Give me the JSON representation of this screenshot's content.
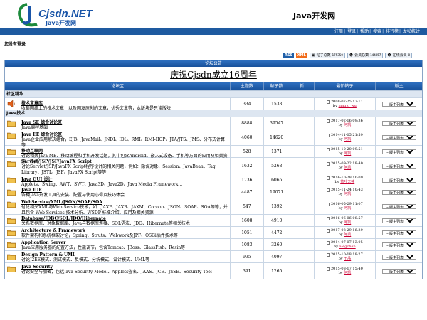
{
  "header": {
    "logo_text": "Cjsdn.NET",
    "logo_sub": "Java开发网",
    "site_title": "Java开发网"
  },
  "nav": [
    "注册",
    "登录",
    "帮助",
    "搜索",
    "排行榜",
    "发帖统计"
  ],
  "not_logged": "您没有登录",
  "infobar": {
    "rss": "RSS",
    "xml": "XML",
    "posts_label": "帖子总数",
    "posts_value": "175350",
    "members_label": "会员总数",
    "members_value": "144057",
    "online_label": "在线会员",
    "online_value": "0"
  },
  "announce_title": "论坛公告",
  "announce_text": "庆祝Cjsdn成立16周年",
  "columns": [
    "论坛区",
    "主题数",
    "帖子数",
    "新",
    "最新帖子",
    "版主"
  ],
  "moderator_option": "---版主列表---",
  "categories": [
    {
      "name": "社区精华",
      "forums": [
        {
          "title": "技术文章库",
          "desc": "收集网络上的技术文章，以及网友原创的文章，优秀文章等，本版块是只读版块",
          "topics": "334",
          "posts": "1533",
          "time": "2008-07-25 17:11",
          "by": "magic_wu",
          "icon": "speaker"
        }
      ]
    },
    {
      "name": "Java技术",
      "forums": [
        {
          "title": "Java SE 综合讨论区",
          "desc": "Java编程基础",
          "topics": "8888",
          "posts": "39547",
          "time": "2017-02-16 09:36",
          "by": "阿凯"
        },
        {
          "title": "Java EE 综合讨论区",
          "desc": "Java企业应用解决组合，EJB、JavaMail、JNDI、IDL、RMI、RMI-IIOP、JTA/JTS、JMS、分布式计算等",
          "topics": "4060",
          "posts": "14620",
          "time": "2014-11-05 21:59",
          "by": "阿凯"
        },
        {
          "title": "移动互联网",
          "desc": "讨论相关Java ME、移动编程和手机开发话题，其中包含Android、嵌入式设备、手机等方面的应用及相关资源、新闻",
          "topics": "528",
          "posts": "1371",
          "time": "2015-10-20 09:51",
          "by": "阿凯"
        },
        {
          "title": "Servlet/JSP/JSF/JavaFX Script",
          "desc": "讨论Servlet/JSP/JavaFX Script程序设计的相关问题，例如：隐含对象、Session、JavaBean、Tag Library、JSTL、JSF、JavaFX Script等等",
          "topics": "1632",
          "posts": "5268",
          "time": "2015-09-22 18:40",
          "by": "阿凯"
        },
        {
          "title": "Java GUI 设计",
          "desc": "Applets、Swing、AWT、SWT、Java3D、Java2D、Java Media Framework...",
          "topics": "1736",
          "posts": "6065",
          "time": "2016-10-28 10:09",
          "by": "蓝叶无神"
        },
        {
          "title": "Java IDE",
          "desc": "各种Java开发工具的安装、配置与使用心得及技巧体会",
          "topics": "4487",
          "posts": "19071",
          "time": "2015-11-24 10:43",
          "by": "阿凯"
        },
        {
          "title": "WebService/XML/JSON/SOAP/SOA",
          "desc": "讨论相关XML与Web Service技术，如：JAXP、JAXB、JAXM、Cocoon、JSON、SOAP、SOA等等；并且包含 Web Services 技术分析、WSDP 标准介绍、应用及相关资源",
          "topics": "547",
          "posts": "1392",
          "time": "2016-05-29 11:07",
          "by": "阿凯"
        },
        {
          "title": "Database/JDBC/SQL/JDO/Hibernate",
          "desc": "关系数据库、对象数据库、Java与数据库连接、SQL语法、JDO、Hibernate等相关技术",
          "topics": "1608",
          "posts": "4910",
          "time": "2016-06-06 08:57",
          "by": "阿凯"
        },
        {
          "title": "Architecture & Framework",
          "desc": "软件架构和系统框架讨论，Spring、Struts、Webwork及JPF、OSGi插件技术等",
          "topics": "1051",
          "posts": "4472",
          "time": "2017-03-29 16:39",
          "by": "阿凯"
        },
        {
          "title": "Application Server",
          "desc": "Java应用服务器的配置方法，性能调节，包含Tomcat、JBoss、GlassFish、Resin等",
          "topics": "1083",
          "posts": "3260",
          "time": "2014-07-07 13:05",
          "by": "alegchen"
        },
        {
          "title": "Design Pattern & UML",
          "desc": "讨论J2EE模式、测试模式、反模式、分析模式、设计模式、UML等",
          "topics": "995",
          "posts": "4097",
          "time": "2015-10-18 18:27",
          "by": "王品"
        },
        {
          "title": "Java Security",
          "desc": "讨论安全与加密，包括Java Security Model、Applets签名、JAAS、JCE、JSSE、Security Tool",
          "topics": "391",
          "posts": "1265",
          "time": "2015-08-17 15:40",
          "by": "阿凯"
        }
      ]
    }
  ],
  "colors": {
    "nav_bar": "#1e5aa0",
    "header_bar": "#18519b",
    "category_bg": "#dde6f1",
    "link_red": "#cc0033"
  }
}
